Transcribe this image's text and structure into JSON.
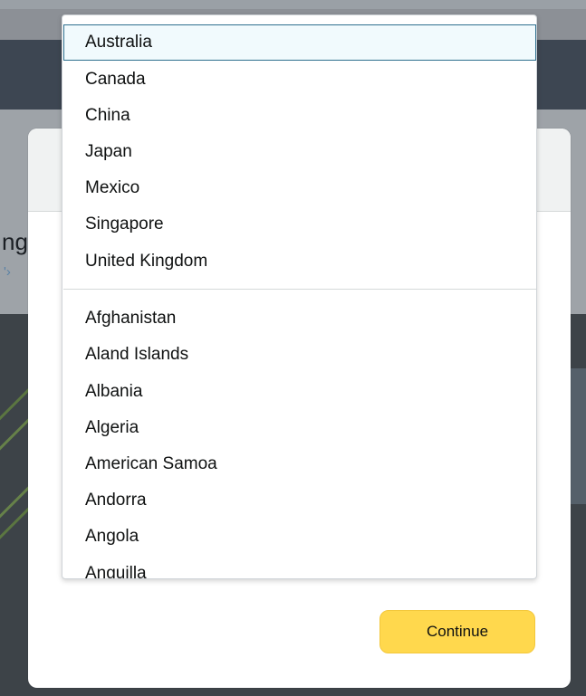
{
  "background": {
    "partial_heading": "ng",
    "partial_link": "'›"
  },
  "dropdown": {
    "featured": [
      "Australia",
      "Canada",
      "China",
      "Japan",
      "Mexico",
      "Singapore",
      "United Kingdom"
    ],
    "all": [
      "Afghanistan",
      "Aland Islands",
      "Albania",
      "Algeria",
      "American Samoa",
      "Andorra",
      "Angola",
      "Anguilla"
    ],
    "selected": "Australia"
  },
  "modal": {
    "continue_label": "Continue"
  },
  "colors": {
    "accent_button": "#ffd84d",
    "selected_border": "#2e6f8e",
    "selected_bg": "#f1fafd"
  }
}
